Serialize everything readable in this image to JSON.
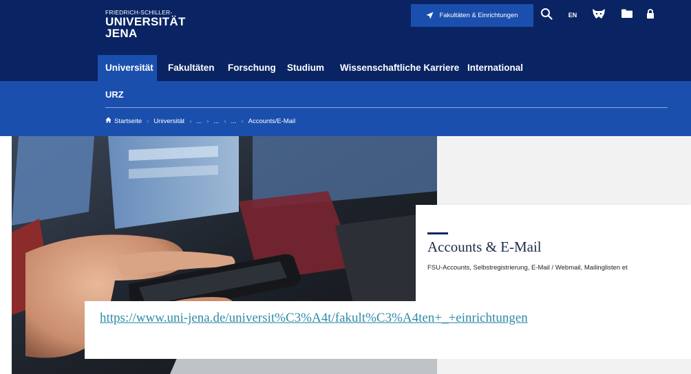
{
  "logo": {
    "line1": "FRIEDRICH-SCHILLER-",
    "line2": "UNIVERSITÄT",
    "line3": "JENA"
  },
  "header": {
    "quick_link_label": "Fakultäten & Einrichtungen",
    "language_label": "EN",
    "icons": [
      "location-arrow-icon",
      "search-icon",
      "wolf-icon",
      "folder-icon",
      "lock-icon"
    ]
  },
  "main_nav": {
    "items": [
      {
        "label": "Universität",
        "active": true
      },
      {
        "label": "Fakultäten"
      },
      {
        "label": "Forschung"
      },
      {
        "label": "Studium"
      },
      {
        "label": "Wissenschaftliche Karriere"
      },
      {
        "label": "International"
      }
    ]
  },
  "section": {
    "title": "URZ"
  },
  "breadcrumb": {
    "home": "Startseite",
    "items": [
      "Universität",
      "...",
      "...",
      "...",
      "Accounts/E-Mail"
    ]
  },
  "card": {
    "title": "Accounts & E-Mail",
    "description": "FSU-Accounts, Selbstregistrierung, E-Mail / Webmail, Mailinglisten et"
  },
  "url_overlay": {
    "text": "https://www.uni-jena.de/universit%C3%A4t/fakult%C3%A4ten+_+einrichtungen"
  },
  "colors": {
    "header_dark": "#0a2463",
    "header_blue": "#1b4fae",
    "link": "#2e8ba7"
  }
}
